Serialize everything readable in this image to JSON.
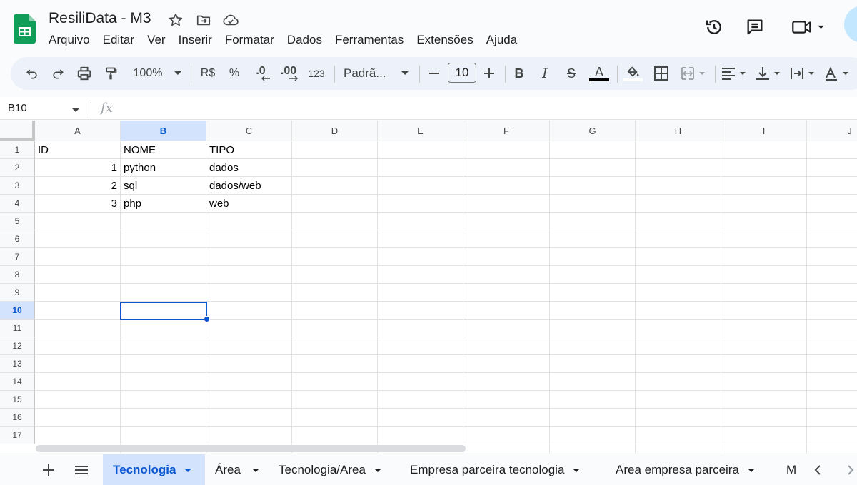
{
  "app": {
    "title": "ResiliData - M3",
    "brand_color": "#0f9d58",
    "accent_color": "#0b57d0"
  },
  "menubar": [
    "Arquivo",
    "Editar",
    "Ver",
    "Inserir",
    "Formatar",
    "Dados",
    "Ferramentas",
    "Extensões",
    "Ajuda"
  ],
  "toolbar": {
    "zoom": "100%",
    "currency": "R$",
    "percent": "%",
    "decrease_decimals": ".0",
    "increase_decimals": ".00",
    "number_format": "123",
    "font_name": "Padrã...",
    "font_size": "10",
    "bold": "B",
    "italic": "I",
    "strikethrough": "S",
    "text_color_label": "A",
    "text_color": "#000000"
  },
  "formula_bar": {
    "name_box": "B10",
    "fx": "fx",
    "value": ""
  },
  "columns": [
    "A",
    "B",
    "C",
    "D",
    "E",
    "F",
    "G",
    "H",
    "I",
    "J"
  ],
  "selected_column": "B",
  "rows": [
    "1",
    "2",
    "3",
    "4",
    "5",
    "6",
    "7",
    "8",
    "9",
    "10",
    "11",
    "12",
    "13",
    "14",
    "15",
    "16",
    "17"
  ],
  "selected_row": "10",
  "selected_cell": "B10",
  "cells": {
    "A1": "ID",
    "B1": "NOME",
    "C1": "TIPO",
    "A2": "1",
    "B2": "python",
    "C2": "dados",
    "A3": "2",
    "B3": "sql",
    "C3": "dados/web",
    "A4": "3",
    "B4": "php",
    "C4": "web"
  },
  "sheet_tabs": [
    {
      "label": "Tecnologia",
      "active": true
    },
    {
      "label": "Área",
      "active": false
    },
    {
      "label": "Tecnologia/Area",
      "active": false
    },
    {
      "label": "Empresa parceira tecnologia",
      "active": false
    },
    {
      "label": "Area empresa parceira",
      "active": false
    },
    {
      "label": "M",
      "active": false
    }
  ],
  "icons": {
    "title": [
      "star-icon",
      "move-to-folder-icon",
      "cloud-saved-icon"
    ],
    "header_right": [
      "version-history-icon",
      "comments-icon",
      "meet-icon"
    ],
    "toolbar": [
      "undo-icon",
      "redo-icon",
      "print-icon",
      "paint-format-icon",
      "fill-color-icon",
      "borders-icon",
      "merge-cells-icon",
      "horizontal-align-icon",
      "vertical-align-icon",
      "text-wrap-icon",
      "text-rotation-icon"
    ],
    "tabs": [
      "add-sheet-icon",
      "all-sheets-icon",
      "scroll-left-icon",
      "scroll-right-icon"
    ]
  }
}
